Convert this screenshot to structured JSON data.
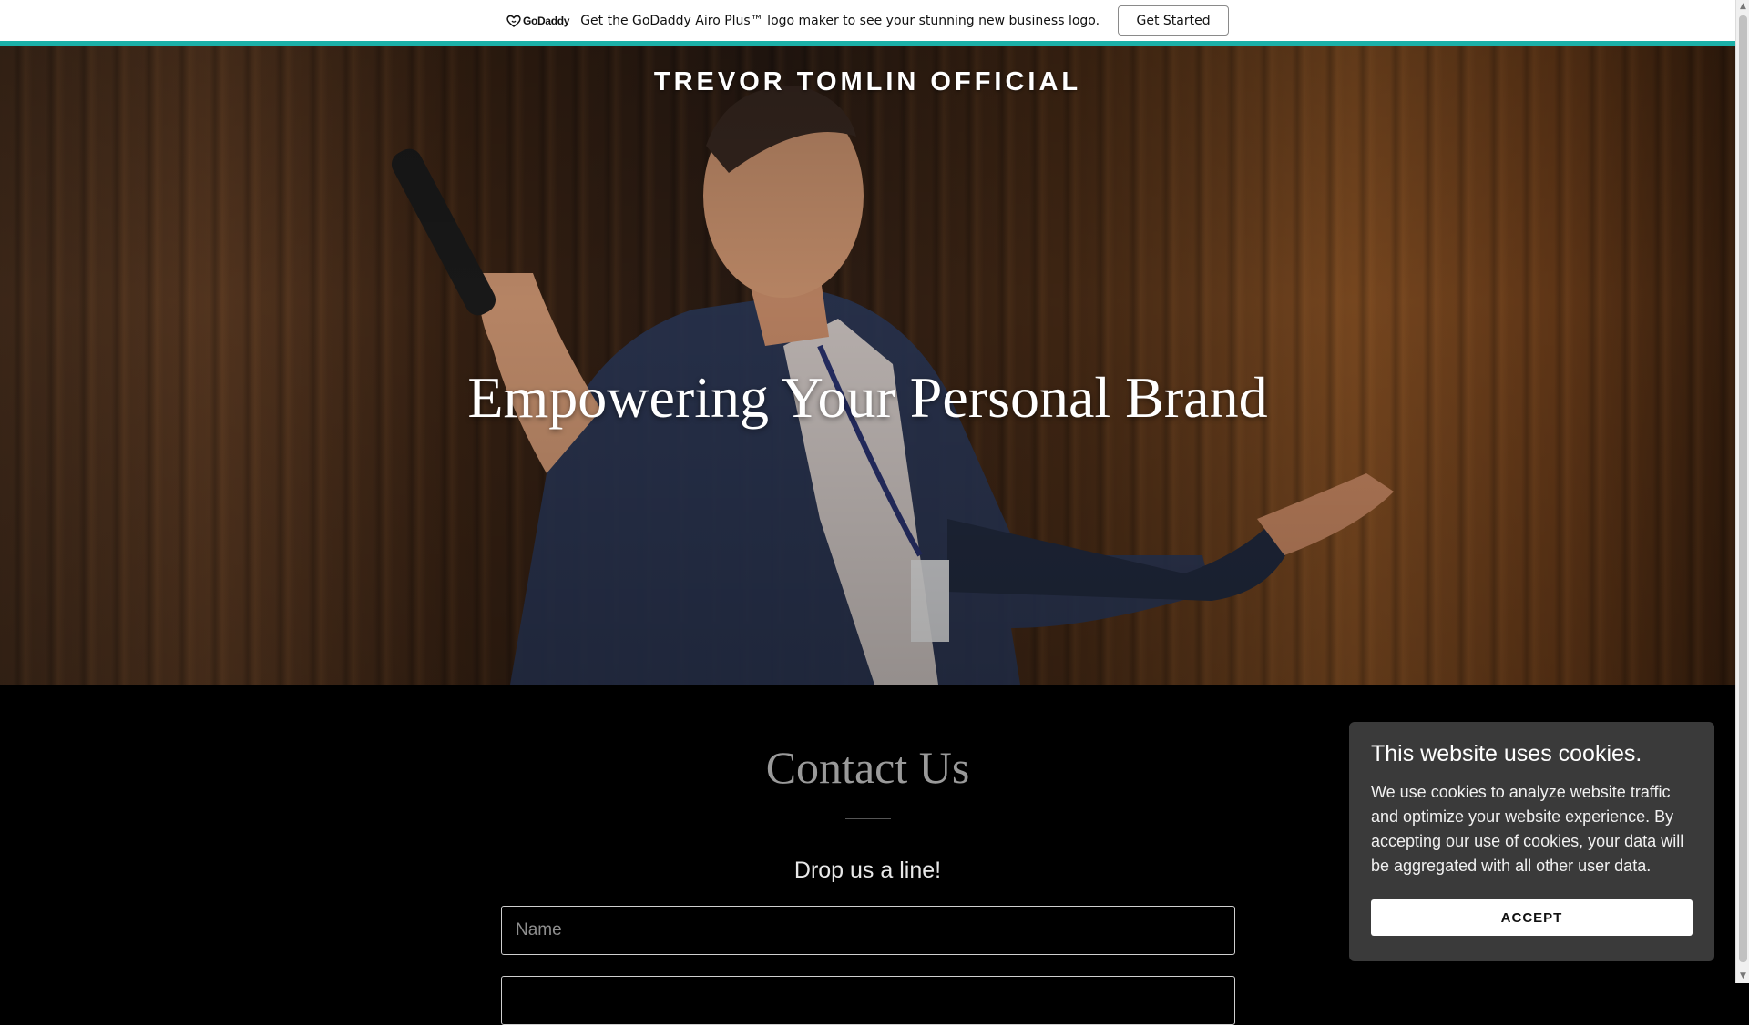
{
  "promo": {
    "logo_text": "GoDaddy",
    "message": "Get the GoDaddy Airo Plus™ logo maker to see your stunning new business logo.",
    "button_label": "Get Started",
    "accent_color": "#1bb0a8"
  },
  "hero": {
    "site_title": "TREVOR TOMLIN OFFICIAL",
    "heading": "Empowering Your Personal Brand"
  },
  "contact": {
    "title": "Contact Us",
    "subtitle": "Drop us a line!",
    "name_placeholder": "Name",
    "email_placeholder": ""
  },
  "cookie": {
    "title": "This website uses cookies.",
    "body": "We use cookies to analyze website traffic and optimize your website experience. By accepting our use of cookies, your data will be aggregated with all other user data.",
    "accept_label": "ACCEPT"
  }
}
